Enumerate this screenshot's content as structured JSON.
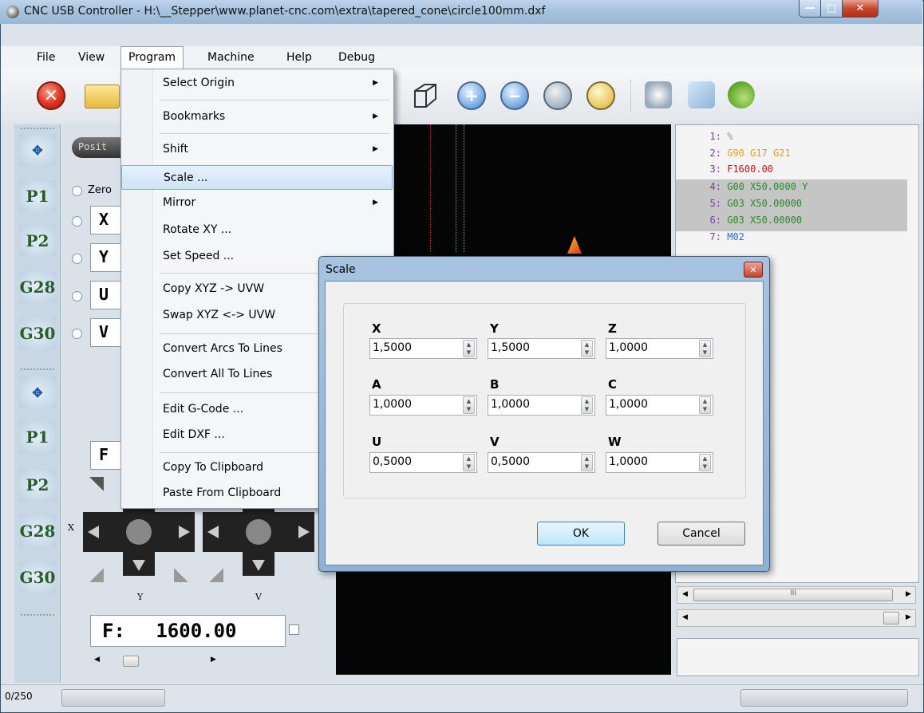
{
  "window": {
    "title": "CNC USB Controller - H:\\__Stepper\\www.planet-cnc.com\\extra\\tapered_cone\\circle100mm.dxf"
  },
  "menubar": [
    "File",
    "View",
    "Program",
    "Machine",
    "Help",
    "Debug"
  ],
  "program_menu": {
    "items": [
      {
        "label": "Select Origin",
        "submenu": true
      },
      {
        "label": "Bookmarks",
        "submenu": true
      },
      {
        "label": "Shift",
        "submenu": true
      },
      {
        "label": "Scale ...",
        "submenu": false,
        "highlighted": true
      },
      {
        "label": "Mirror",
        "submenu": true
      },
      {
        "label": "Rotate XY ...",
        "submenu": false
      },
      {
        "label": "Set Speed ...",
        "submenu": false
      },
      {
        "label": "Copy XYZ -> UVW",
        "submenu": false
      },
      {
        "label": "Swap XYZ <-> UVW",
        "submenu": false
      },
      {
        "label": "Convert Arcs To Lines",
        "submenu": false
      },
      {
        "label": "Convert All To Lines",
        "submenu": false
      },
      {
        "label": "Edit G-Code ...",
        "submenu": false
      },
      {
        "label": "Edit DXF ...",
        "submenu": false
      },
      {
        "label": "Copy To Clipboard",
        "submenu": false
      },
      {
        "label": "Paste From Clipboard",
        "submenu": false
      }
    ]
  },
  "left_strip": [
    "P1",
    "P2",
    "G28",
    "G30",
    "P1",
    "P2",
    "G28",
    "G30"
  ],
  "left_panel": {
    "tab_label": "Posit",
    "zero_label": "Zero",
    "axes": [
      "X",
      "Y",
      "U",
      "V"
    ],
    "feed_short": "F",
    "jog_labels": [
      "X",
      "Y",
      "V"
    ],
    "feed_label": "F:",
    "feed_value": "1600.00"
  },
  "code_lines": [
    {
      "num": "1:",
      "text": "%",
      "color": "#999999"
    },
    {
      "num": "2:",
      "text": "G90 G17 G21",
      "color": "#e0a020"
    },
    {
      "num": "3:",
      "text": "F1600.00",
      "color": "#d01010"
    },
    {
      "num": "4:",
      "text": "G00 X50.0000 Y",
      "color": "#2a8a2a"
    },
    {
      "num": "5:",
      "text": "G03 X50.00000",
      "color": "#2a8a2a"
    },
    {
      "num": "6:",
      "text": "G03 X50.00000",
      "color": "#2a8a2a"
    },
    {
      "num": "7:",
      "text": "M02",
      "color": "#2a6ad0"
    }
  ],
  "code_scroll_label": "III",
  "dialog": {
    "title": "Scale",
    "fields": [
      {
        "label": "X",
        "value": "1,5000"
      },
      {
        "label": "Y",
        "value": "1,5000"
      },
      {
        "label": "Z",
        "value": "1,0000"
      },
      {
        "label": "A",
        "value": "1,0000"
      },
      {
        "label": "B",
        "value": "1,0000"
      },
      {
        "label": "C",
        "value": "1,0000"
      },
      {
        "label": "U",
        "value": "0,5000"
      },
      {
        "label": "V",
        "value": "0,5000"
      },
      {
        "label": "W",
        "value": "1,0000"
      }
    ],
    "ok_label": "OK",
    "cancel_label": "Cancel"
  },
  "status": {
    "count": "0/250"
  },
  "colors": {
    "title_bar": "#a6c1dd",
    "highlight": "#cfe3f8",
    "canvas": "#050505",
    "close_button": "#c7472e"
  }
}
